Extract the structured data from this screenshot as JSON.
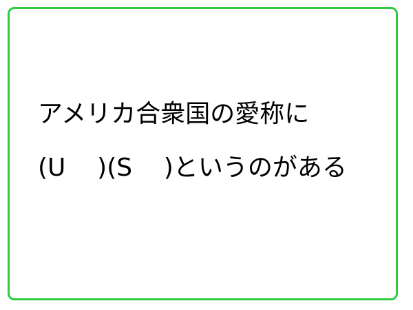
{
  "quiz": {
    "line1": "アメリカ合衆国の愛称に",
    "line2": "(U    )(S    )というのがある"
  },
  "colors": {
    "border": "#2ecc40",
    "background": "#ffffff",
    "text": "#000000"
  }
}
